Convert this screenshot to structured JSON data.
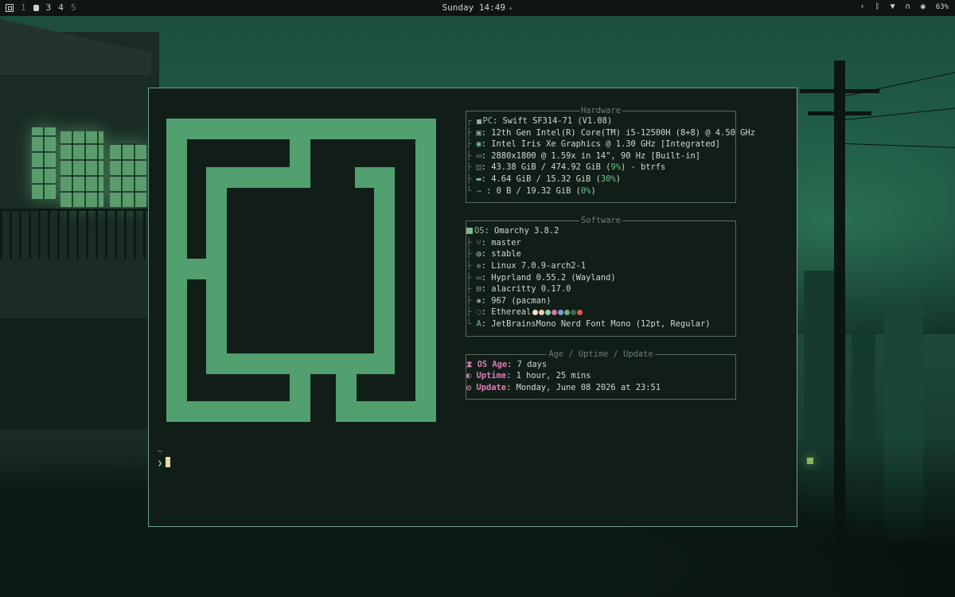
{
  "topbar": {
    "workspaces": [
      "1",
      "3",
      "4",
      "5"
    ],
    "clock": "Sunday 14:49",
    "battery_percent": "63%"
  },
  "fetch": {
    "hardware": {
      "title": "Hardware",
      "pc_label": "PC",
      "pc": "Swift SF314-71 (V1.08)",
      "cpu": "12th Gen Intel(R) Core(TM) i5-12500H (8+8) @ 4.50 GHz",
      "gpu": "Intel Iris Xe Graphics @ 1.30 GHz [Integrated]",
      "display": "2880x1800 @ 1.59x in 14\", 90 Hz [Built-in]",
      "disk_a": "43.38 GiB / 474.92 GiB (",
      "disk_pct": "9%",
      "disk_b": ") - btrfs",
      "mem_a": "4.64 GiB / 15.32 GiB (",
      "mem_pct": "30%",
      "mem_b": ")",
      "swap_a": "0 B / 19.32 GiB (",
      "swap_pct": "0%",
      "swap_b": ")"
    },
    "software": {
      "title": "Software",
      "os_label": "OS",
      "os": "Omarchy 3.8.2",
      "branch": "master",
      "channel": "stable",
      "kernel": "Linux 7.0.9-arch2-1",
      "wm": "Hyprland 0.55.2 (Wayland)",
      "terminal": "alacritty 0.17.0",
      "packages": "967 (pacman)",
      "theme": "Ethereal",
      "font": "JetBrainsMono Nerd Font Mono (12pt, Regular)"
    },
    "age": {
      "title": "Age / Uptime / Update",
      "os_age_label": "OS Age",
      "os_age": "7 days",
      "uptime_label": "Uptime",
      "uptime": "1 hour, 25 mins",
      "update_label": "Update",
      "update": "Monday, June 08 2026 at 23:51"
    }
  },
  "prompt": {
    "dir": "~",
    "symbol": "❯"
  },
  "colors": {
    "accent": "#52a06f",
    "theme_swatches": [
      "#f2e6c2",
      "#e8c9b6",
      "#8fd0a4",
      "#d9799a",
      "#6fa0c8",
      "#7aa58a",
      "#3b6a52",
      "#e05a4a"
    ]
  }
}
